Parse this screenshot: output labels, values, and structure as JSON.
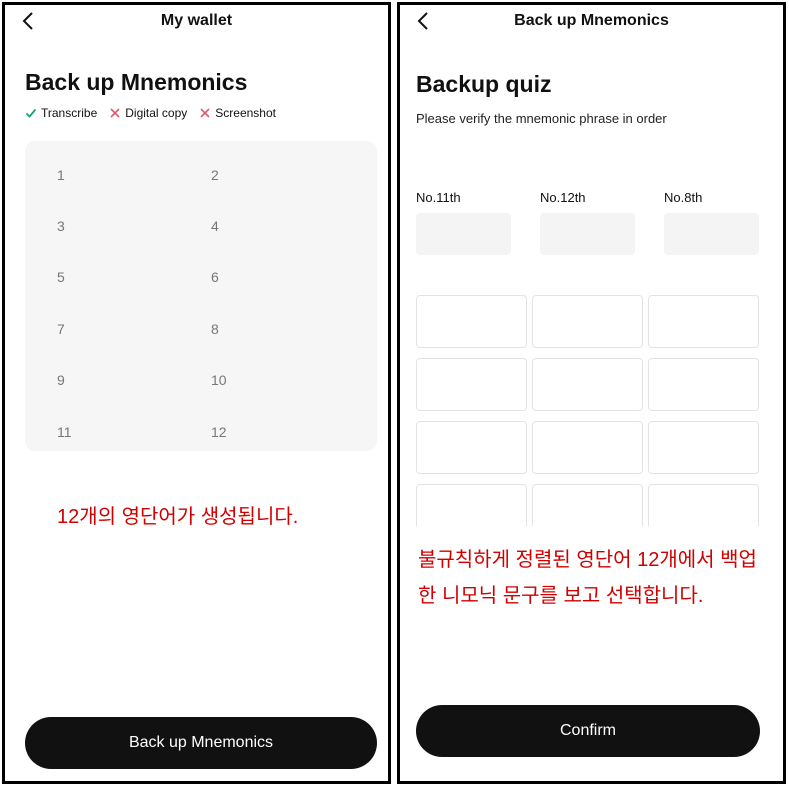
{
  "left": {
    "nav_title": "My wallet",
    "heading": "Back up Mnemonics",
    "checks": [
      {
        "label": "Transcribe",
        "status": "allowed",
        "icon": "check-icon",
        "color": "#1aa36f"
      },
      {
        "label": "Digital copy",
        "status": "forbidden",
        "icon": "cross-icon",
        "color": "#e05a6a"
      },
      {
        "label": "Screenshot",
        "status": "forbidden",
        "icon": "cross-icon",
        "color": "#e05a6a"
      }
    ],
    "word_numbers": [
      "1",
      "2",
      "3",
      "4",
      "5",
      "6",
      "7",
      "8",
      "9",
      "10",
      "11",
      "12"
    ],
    "annotation": "12개의 영단어가 생성됩니다.",
    "button_label": "Back up Mnemonics"
  },
  "right": {
    "nav_title": "Back up Mnemonics",
    "heading": "Backup quiz",
    "subtitle": "Please verify the mnemonic phrase in order",
    "slots": [
      {
        "label": "No.11th"
      },
      {
        "label": "No.12th"
      },
      {
        "label": "No.8th"
      }
    ],
    "annotation": "불규칙하게 정렬된 영단어 12개에서 백업한 니모닉 문구를 보고 선택합니다.",
    "button_label": "Confirm"
  },
  "colors": {
    "annotation": "#d00000",
    "button_bg": "#111111",
    "panel_border": "#000000"
  }
}
